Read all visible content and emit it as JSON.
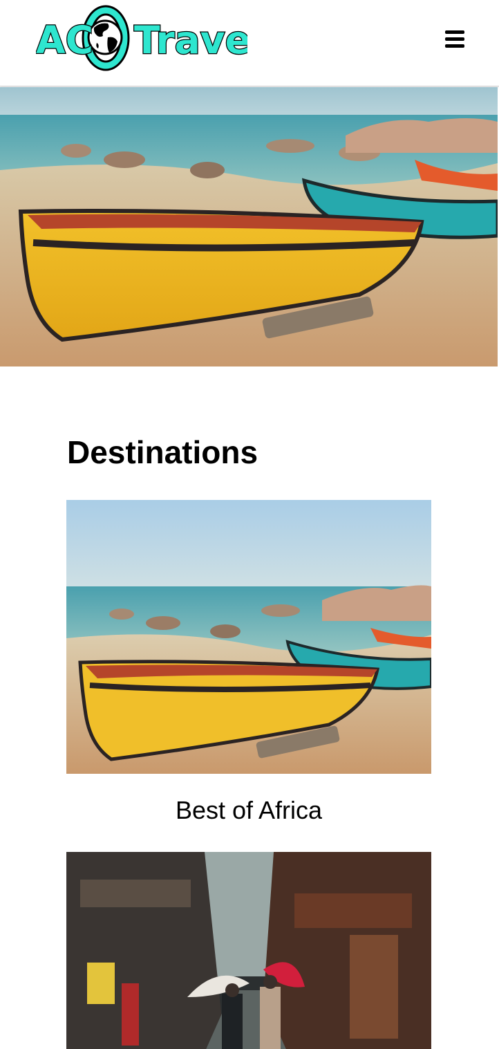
{
  "brand": {
    "logo_text": "AC Travel",
    "logo_left": "AC",
    "logo_right": "Travel",
    "accent": "#2ee6cf"
  },
  "header": {
    "menu_icon": "hamburger-icon"
  },
  "hero": {
    "image": "yellow-boat-beach-photo"
  },
  "destinations": {
    "title": "Destinations",
    "items": [
      {
        "label": "Best of Africa",
        "image": "yellow-boat-beach-photo"
      },
      {
        "label": "",
        "image": "japanese-street-umbrellas-photo"
      }
    ]
  }
}
